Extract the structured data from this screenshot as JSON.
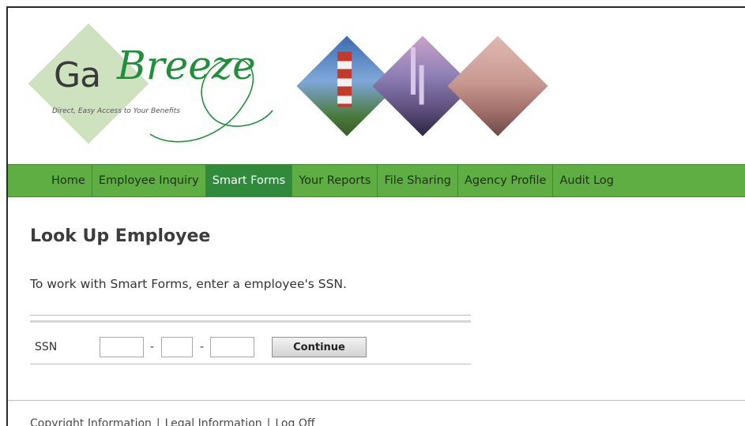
{
  "header": {
    "logo": {
      "ga": "Ga",
      "breeze": "Breeze",
      "tagline": "Direct, Easy Access to Your Benefits"
    }
  },
  "nav": {
    "items": [
      {
        "label": "Home"
      },
      {
        "label": "Employee Inquiry"
      },
      {
        "label": "Smart Forms"
      },
      {
        "label": "Your Reports"
      },
      {
        "label": "File Sharing"
      },
      {
        "label": "Agency Profile"
      },
      {
        "label": "Audit Log"
      }
    ],
    "active_index": 2,
    "active_color": "#2f8a3c",
    "bar_color": "#5fae44"
  },
  "main": {
    "title": "Look Up Employee",
    "instructions": "To work with Smart Forms, enter a employee's SSN.",
    "ssn": {
      "label": "SSN",
      "part1": "",
      "part2": "",
      "part3": "",
      "separator": "-",
      "button_label": "Continue"
    }
  },
  "footer": {
    "links": [
      "Copyright Information",
      "Legal Information",
      "Log Off"
    ],
    "separator": "|"
  }
}
